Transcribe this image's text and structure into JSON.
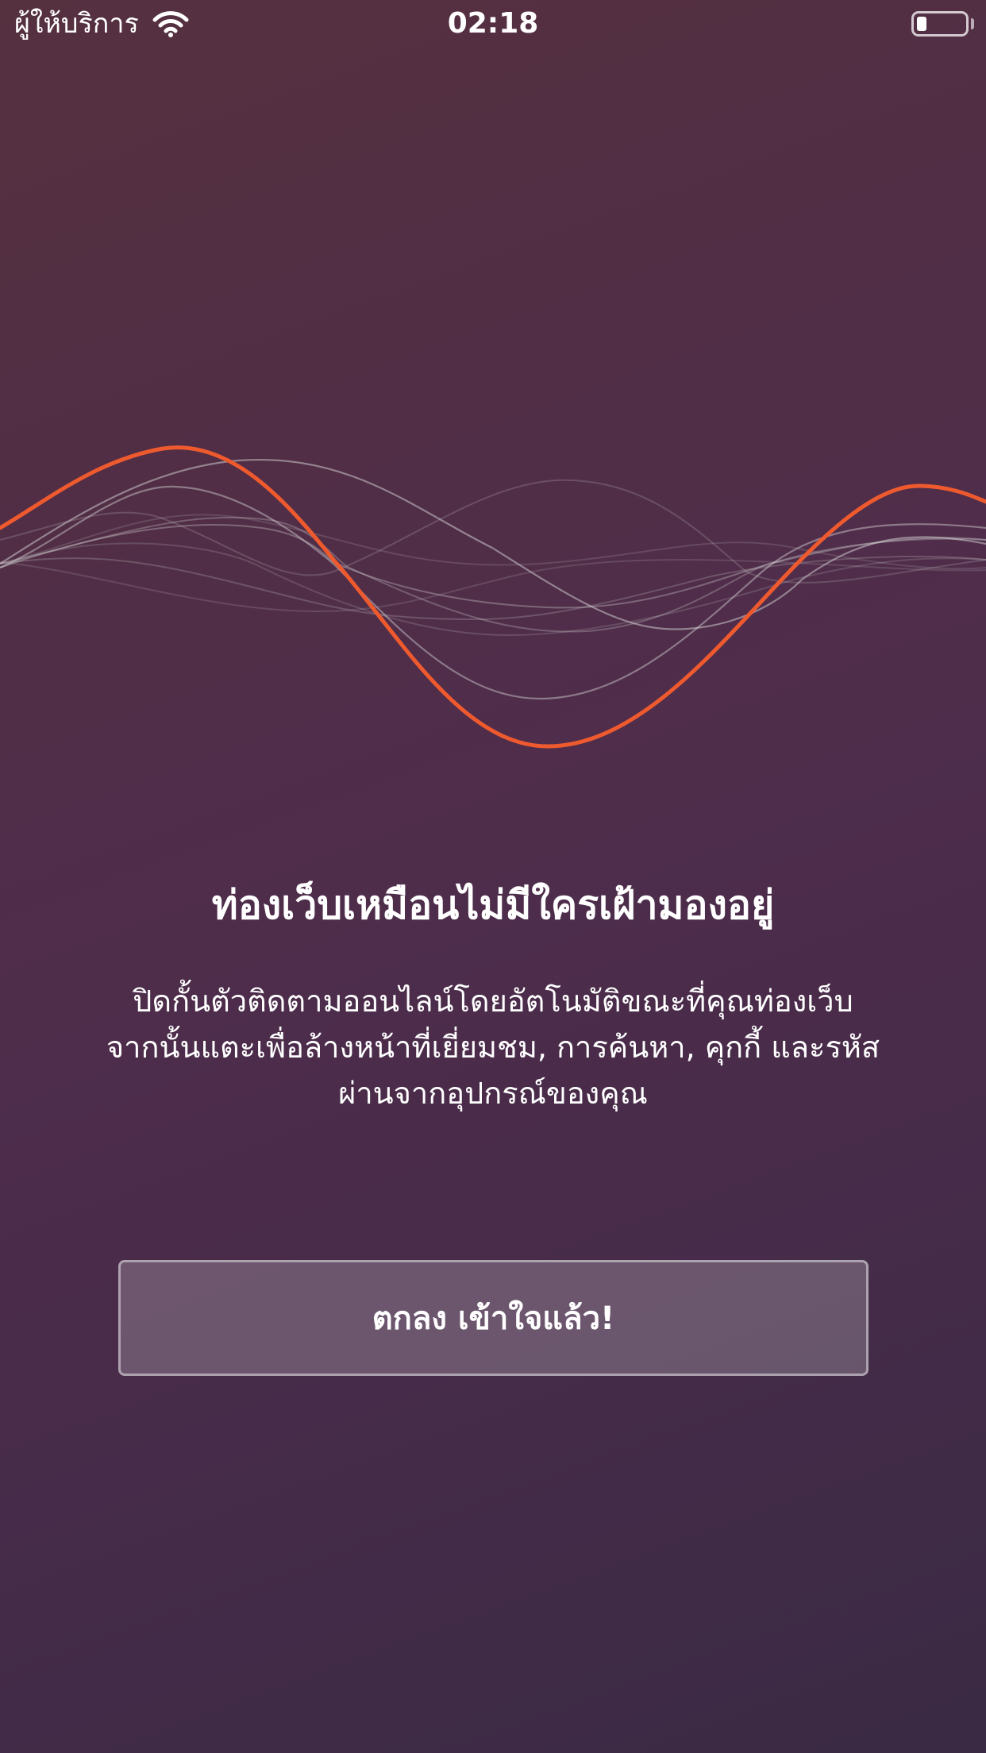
{
  "status_bar": {
    "carrier": "ผู้ให้บริการ",
    "time": "02:18",
    "wifi_icon": "wifi-icon",
    "battery_icon": "battery-icon",
    "battery_level": 0.2
  },
  "onboarding": {
    "heading": "ท่องเว็บเหมือนไม่มีใครเฝ้ามองอยู่",
    "body": "ปิดกั้นตัวติดตามออนไลน์โดยอัตโนมัติขณะที่คุณท่องเว็บ จากนั้นแตะเพื่อล้างหน้าที่เยี่ยมชม, การค้นหา, คุกกี้ และรหัสผ่านจากอุปกรณ์ของคุณ",
    "cta_label": "ตกลง เข้าใจแล้ว!"
  },
  "colors": {
    "accent_wave": "#ee5a2e",
    "background_start": "#55303f",
    "background_end": "#3a2a44"
  }
}
